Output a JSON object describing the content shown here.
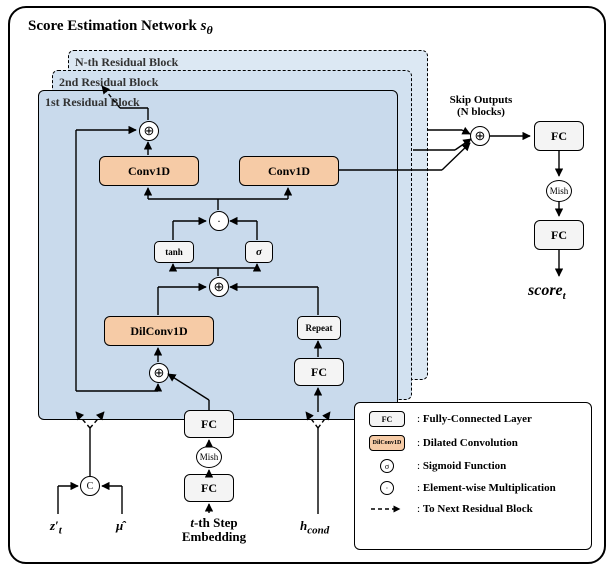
{
  "title_main": "Score Estimation Network ",
  "title_sym": "s",
  "title_sub": "θ",
  "rb": {
    "n": "N-th Residual Block",
    "r2": "2nd Residual Block",
    "r1": "1st Residual Block"
  },
  "blk": {
    "conv1": "Conv1D",
    "conv2": "Conv1D",
    "dil": "DilConv1D",
    "fc": "FC",
    "tanh": "tanh",
    "sigma": "σ",
    "mish": "Mish",
    "repeat": "Repeat"
  },
  "skip": {
    "l1": "Skip Outputs",
    "l2": "(N blocks)"
  },
  "legend": {
    "fc": "Fully-Connected Layer",
    "dil": "Dilated Convolution",
    "sig": "Sigmoid Function",
    "mul": "Element-wise  Multiplication",
    "next": "To Next Residual Block"
  },
  "inputs": {
    "zt": "z′",
    "zt_sub": "t",
    "mu": "μ̂",
    "step1": "t",
    "step2": "-th Step",
    "step3": "Embedding",
    "hcond": "h",
    "hcond_sub": "cond"
  },
  "output": {
    "s": "score",
    "sub": "t"
  },
  "chart_data": {
    "type": "diagram",
    "name": "Score Estimation Network s_theta",
    "residual_blocks": "N",
    "inputs": [
      "z'_t concatenated with mu_hat",
      "t-th Step Embedding",
      "h_cond"
    ],
    "output": "score_t",
    "residual_block_ops": [
      "feature_in = concat(z'_t, mu_hat)",
      "step_emb = FC(Mish(FC(t_step_embedding)))",
      "h = feature_in ⊕ step_emb",
      "h = DilConv1D(h)",
      "cond = Repeat(FC(h_cond))",
      "h = h ⊕ cond",
      "gated = tanh(h_left) ⊙ σ(h_right)",
      "out_feature = Conv1D(gated) ⊕ feature_in  → to next residual block",
      "skip_out = Conv1D(gated)  → to skip sum"
    ],
    "head": [
      "sum = ⊕ over N skip_outputs",
      "score_t = FC(Mish(FC(sum)))"
    ],
    "legend": {
      "FC": "Fully-Connected Layer",
      "DilConv1D": "Dilated Convolution",
      "σ": "Sigmoid Function",
      "⊙": "Element-wise Multiplication",
      "dashed_arrow": "To Next Residual Block"
    }
  }
}
